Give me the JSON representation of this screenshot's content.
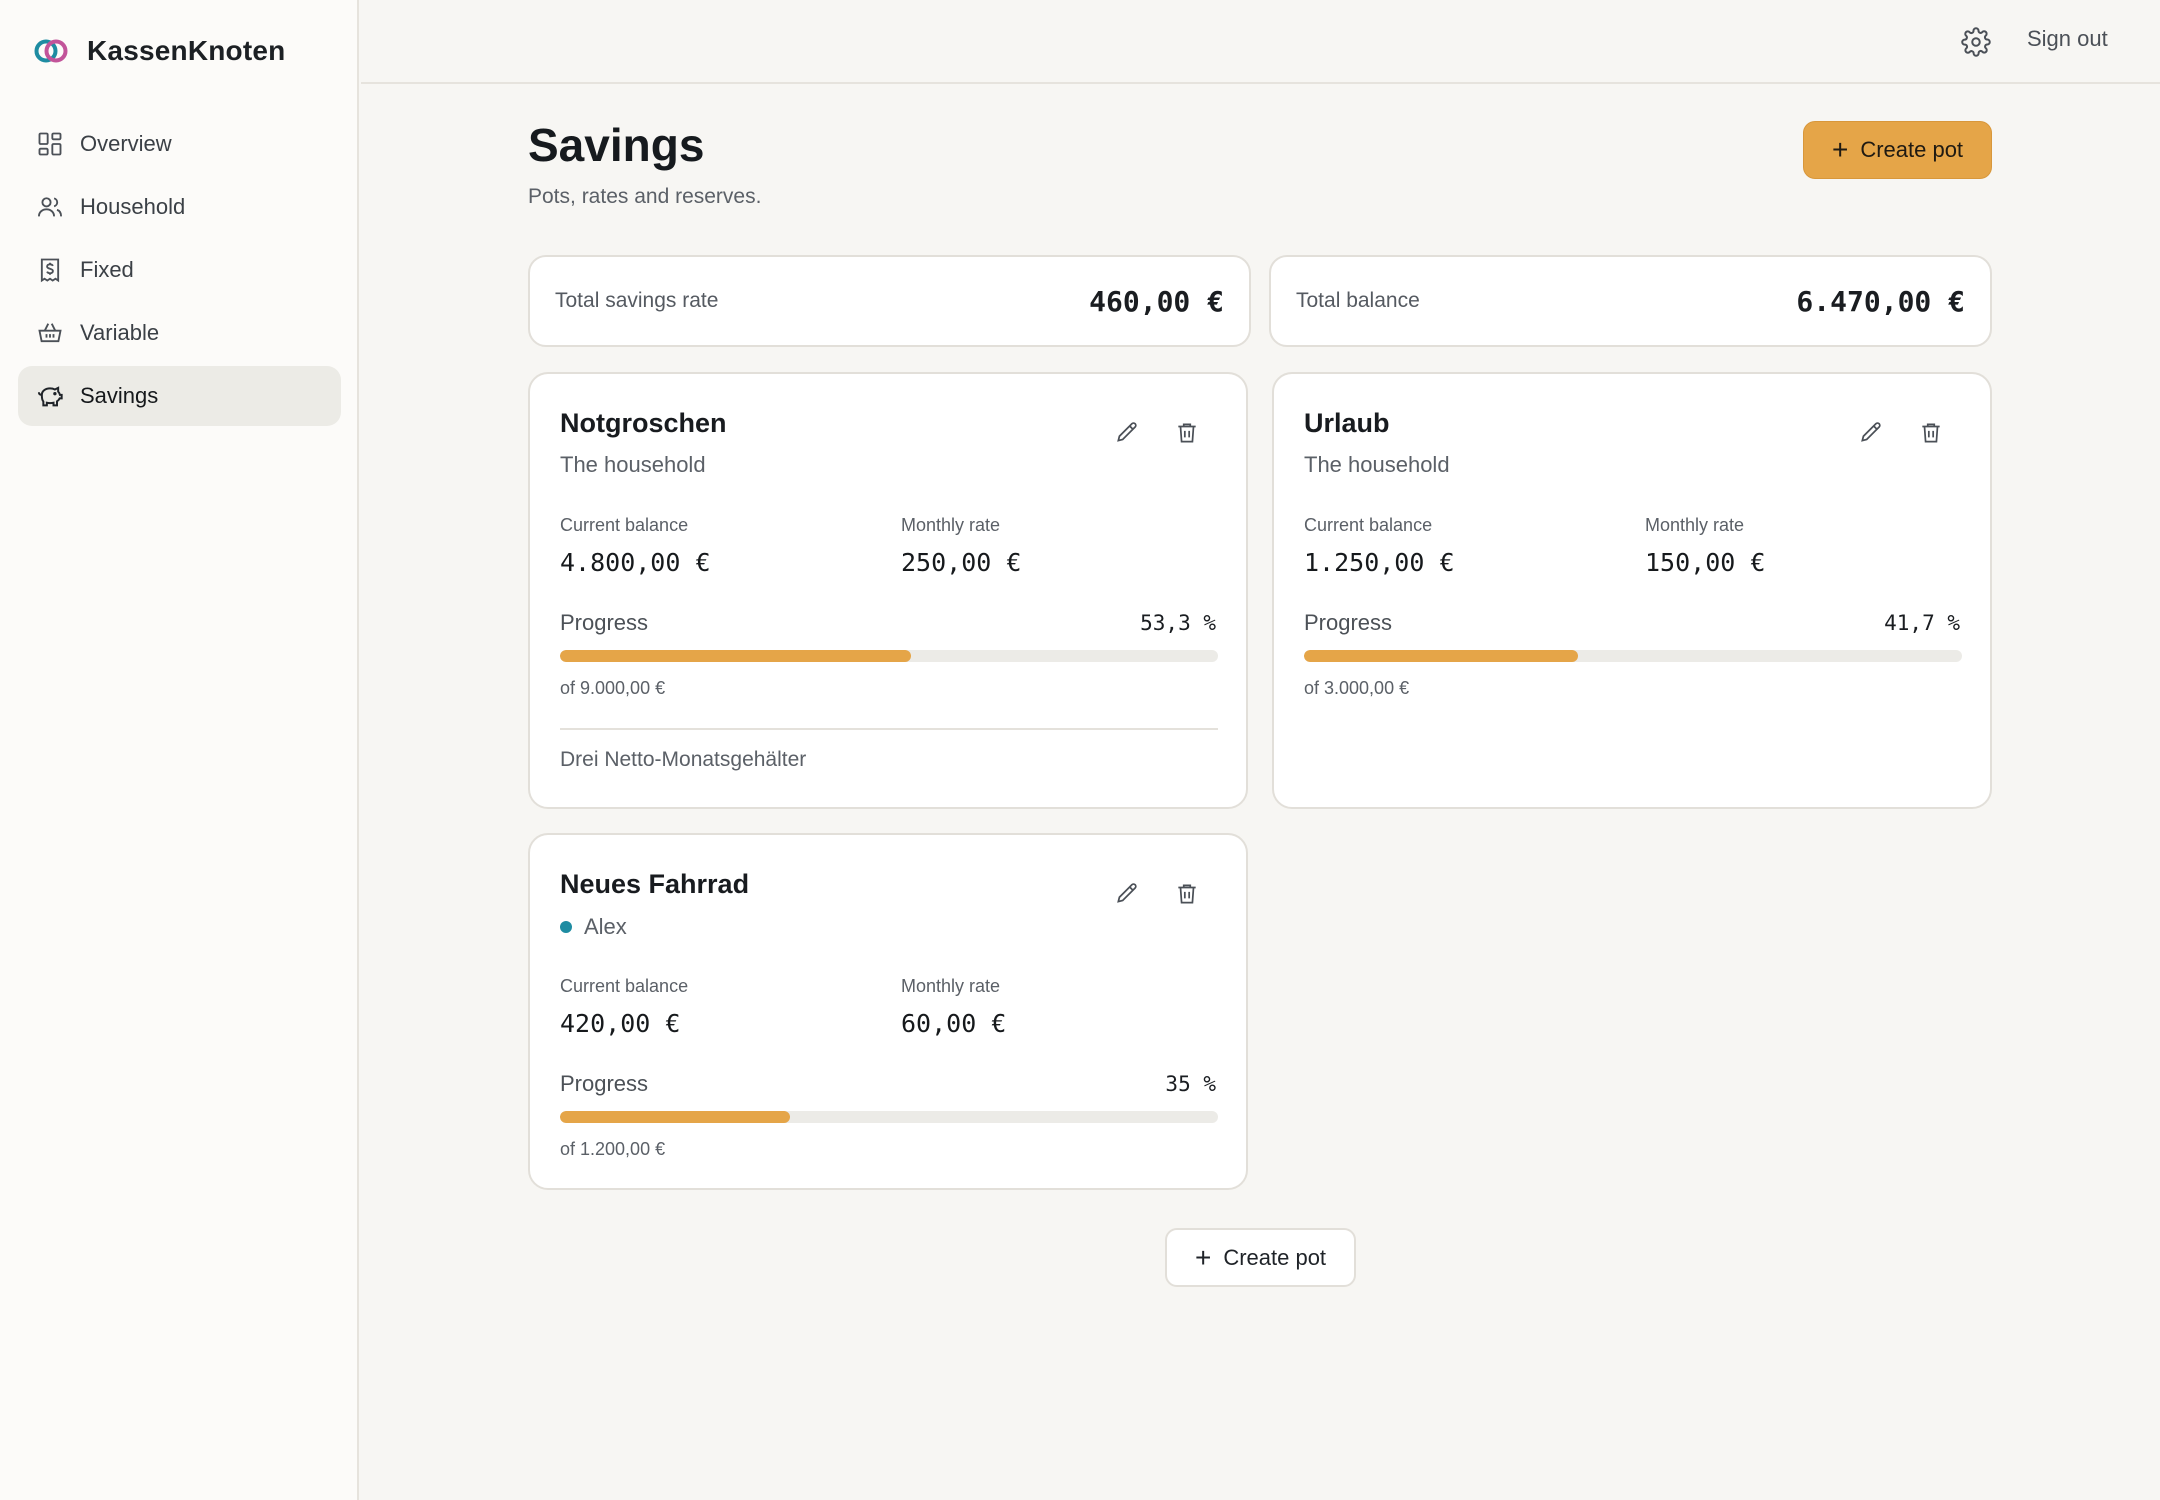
{
  "app": {
    "name": "KassenKnoten",
    "logo_icon": "two-rings-logo",
    "accent": "#e5a548"
  },
  "sidebar": {
    "items": [
      {
        "label": "Overview",
        "icon": "dashboard-icon",
        "active": false
      },
      {
        "label": "Household",
        "icon": "users-icon",
        "active": false
      },
      {
        "label": "Fixed",
        "icon": "receipt-icon",
        "active": false
      },
      {
        "label": "Variable",
        "icon": "basket-icon",
        "active": false
      },
      {
        "label": "Savings",
        "icon": "piggy-bank-icon",
        "active": true
      }
    ]
  },
  "topbar": {
    "settings_icon": "gear-icon",
    "signout_label": "Sign out"
  },
  "header": {
    "title": "Savings",
    "subtitle": "Pots, rates and reserves.",
    "create_label": "Create pot"
  },
  "summary": {
    "rate_label": "Total savings rate",
    "rate_value": "460,00 €",
    "balance_label": "Total balance",
    "balance_value": "6.470,00 €"
  },
  "labels": {
    "current_balance": "Current balance",
    "monthly_rate": "Monthly rate",
    "progress": "Progress"
  },
  "pots": [
    {
      "name": "Notgroschen",
      "owner": "The household",
      "owner_dot": false,
      "balance": "4.800,00 €",
      "rate": "250,00 €",
      "progress_text": "53,3 %",
      "progress": 0.533,
      "target": "of 9.000,00 €",
      "note": "Drei Netto-Monatsgehälter"
    },
    {
      "name": "Urlaub",
      "owner": "The household",
      "owner_dot": false,
      "balance": "1.250,00 €",
      "rate": "150,00 €",
      "progress_text": "41,7 %",
      "progress": 0.417,
      "target": "of 3.000,00 €",
      "note": ""
    },
    {
      "name": "Neues Fahrrad",
      "owner": "Alex",
      "owner_dot": true,
      "owner_color": "#1e8ca2",
      "balance": "420,00 €",
      "rate": "60,00 €",
      "progress_text": "35 %",
      "progress": 0.35,
      "target": "of 1.200,00 €",
      "note": ""
    }
  ],
  "footer": {
    "create_label": "Create pot"
  }
}
